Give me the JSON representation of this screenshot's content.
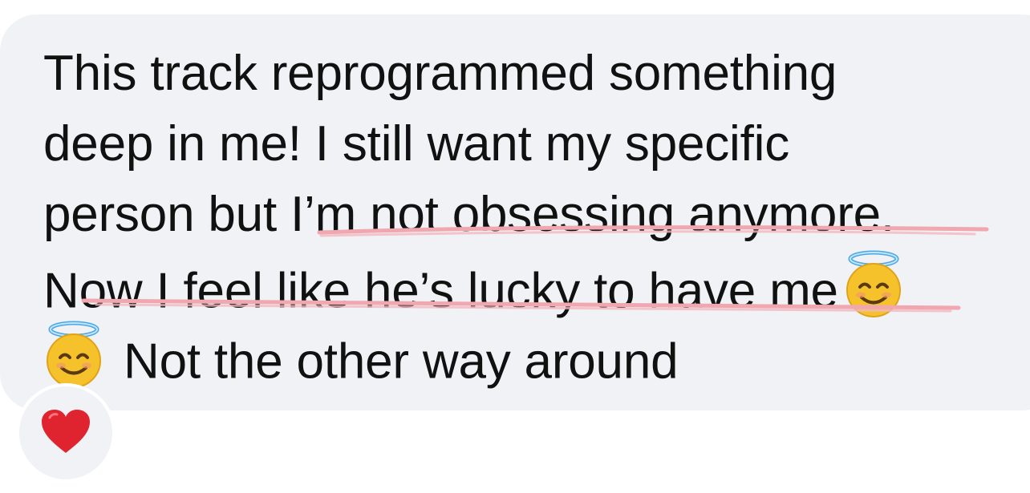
{
  "message": {
    "line1": "This track reprogrammed something",
    "line2": "deep in me! I still want my specific",
    "line3_plain": "person but ",
    "line3_underlined": "I’m not obsessing anymore.",
    "line4": "Now I feel like he’s lucky to have me",
    "line5": "Not the other way around",
    "emoji_1": "smiling-face-with-halo-icon",
    "emoji_2": "smiling-face-with-halo-icon",
    "underline_color": "#f0a7b0"
  },
  "reaction": {
    "icon": "red-heart-icon",
    "color": "#e0242f"
  },
  "colors": {
    "bubble_bg": "#f1f2f5",
    "text": "#111111"
  }
}
